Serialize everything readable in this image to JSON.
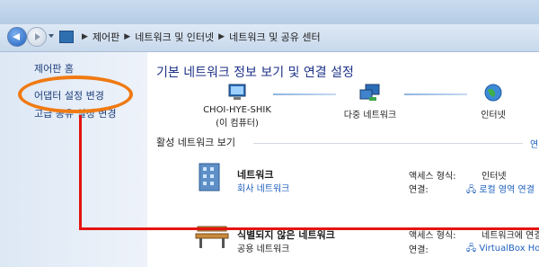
{
  "breadcrumb": [
    "제어판",
    "네트워크 및 인터넷",
    "네트워크 및 공유 센터"
  ],
  "sidebar": {
    "items": [
      {
        "label": "제어판 홈"
      },
      {
        "label": "어댑터 설정 변경"
      },
      {
        "label": "고급 공유 설정 변경"
      }
    ]
  },
  "main": {
    "title": "기본 네트워크 정보 보기 및 연결 설정",
    "map": {
      "computer_name": "CHOI-HYE-SHIK",
      "computer_sub": "(이 컴퓨터)",
      "network": "다중 네트워크",
      "internet": "인터넷"
    },
    "active_section": "활성 네트워크 보기",
    "active_link": "연",
    "networks": [
      {
        "name": "네트워크",
        "type": "회사 네트워크",
        "access_label": "액세스 형식:",
        "access_value": "인터넷",
        "conn_label": "연결:",
        "conn_value": "로컬 영역 연결"
      },
      {
        "name": "식별되지 않은 네트워크",
        "type": "공용 네트워크",
        "access_label": "액세스 형식:",
        "access_value": "네트워크에 연결",
        "conn_label": "연결:",
        "conn_value": "VirtualBox Host"
      }
    ]
  },
  "colors": {
    "annotation_red": "#e4140f",
    "annotation_orange": "#f07a12",
    "link": "#1e5fbf"
  }
}
